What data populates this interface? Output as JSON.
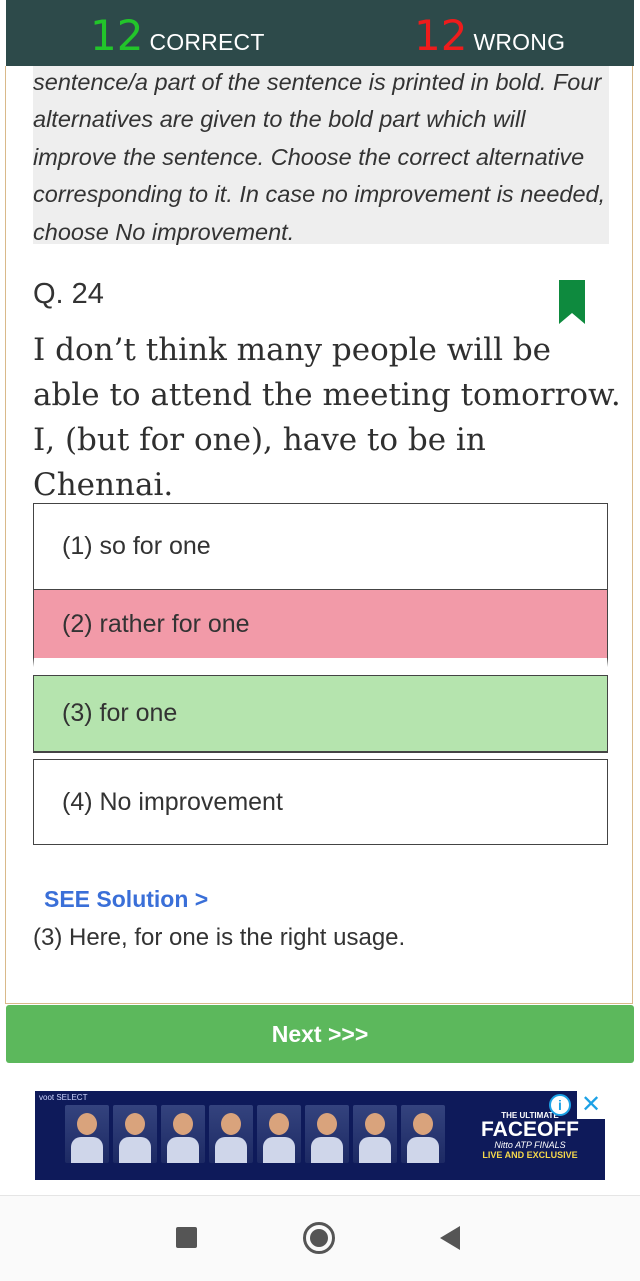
{
  "score": {
    "correct_count": "12",
    "correct_label": "CORRECT",
    "wrong_count": "12",
    "wrong_label": "WRONG"
  },
  "instruction": "sentence/a part of the sentence is printed in bold. Four alternatives are given to the bold part which will improve the sentence. Choose the correct alternative corresponding to it. In case no improvement is needed, choose No improvement.",
  "question": {
    "number": "Q. 24",
    "text": "I don’t think many people will be able to attend the meeting tomorrow. I, (but for one), have to be in Chennai."
  },
  "options": [
    {
      "label": "(1) so for one",
      "state": "neutral"
    },
    {
      "label": "(2) rather for one",
      "state": "wrong"
    },
    {
      "label": "(3) for one",
      "state": "correct"
    },
    {
      "label": "(4) No improvement",
      "state": "neutral"
    }
  ],
  "solution": {
    "link": "SEE Solution >",
    "text": "(3) Here, for one is the right usage."
  },
  "next_button": "Next >>>",
  "ad": {
    "brand": "voot SELECT",
    "small": "THE ULTIMATE",
    "headline": "FACEOFF",
    "sub": "Nitto ATP FINALS",
    "live": "LIVE AND EXCLUSIVE"
  },
  "colors": {
    "header_bg": "#2d4a4a",
    "correct": "#22c52a",
    "wrong": "#ee1c1c",
    "option_wrong_bg": "#f29aa8",
    "option_correct_bg": "#b5e4ae",
    "next_bg": "#5cb85c",
    "bookmark": "#0e8a3e"
  }
}
